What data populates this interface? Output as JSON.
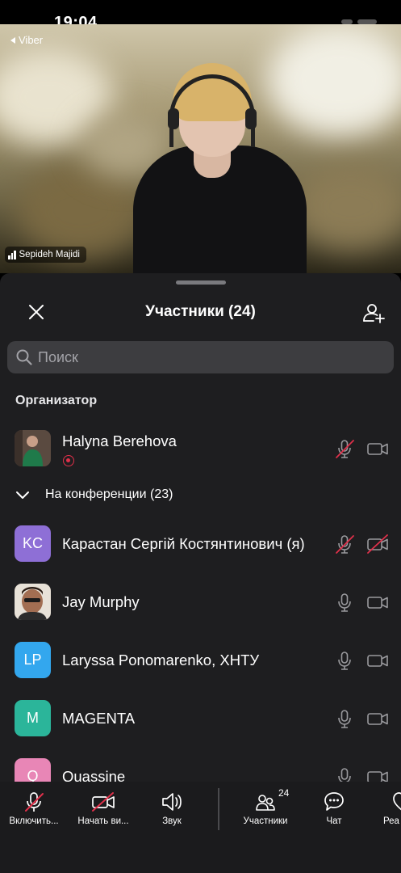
{
  "status": {
    "time": "19:04",
    "back_app": "Viber"
  },
  "video": {
    "speaker_name": "Sepideh Majidi"
  },
  "panel": {
    "title": "Участники (24)",
    "search_placeholder": "Поиск",
    "organizer_label": "Организатор",
    "organizer": {
      "name": "Halyna Berehova",
      "mic": "muted",
      "camera": "on",
      "recording": true
    },
    "group_label": "На конференции (23)",
    "participants": [
      {
        "name": "Карастан Сергій Костянтинович (я)",
        "initials": "KC",
        "avatar_color": "#8e6fd6",
        "mic": "muted",
        "camera": "off"
      },
      {
        "name": "Jay Murphy",
        "initials": "",
        "avatar_color": "#6b5a4a",
        "mic": "on",
        "camera": "on"
      },
      {
        "name": "Laryssa Ponomarenko, ХНТУ",
        "initials": "LP",
        "avatar_color": "#33a7ee",
        "mic": "on",
        "camera": "on"
      },
      {
        "name": "MAGENTA",
        "initials": "M",
        "avatar_color": "#2bb59a",
        "mic": "on",
        "camera": "on"
      },
      {
        "name": "Quassine",
        "initials": "Q",
        "avatar_color": "#e886b6",
        "mic": "on",
        "camera": "on"
      }
    ]
  },
  "toolbar": {
    "mic_label": "Включить...",
    "video_label": "Начать ви...",
    "sound_label": "Звук",
    "participants_label": "Участники",
    "participants_count": "24",
    "chat_label": "Чат",
    "react_label": "Реа"
  },
  "colors": {
    "panel_bg": "#1e1e20",
    "muted_red": "#e0304a",
    "accent_purple": "#8e6fd6"
  }
}
